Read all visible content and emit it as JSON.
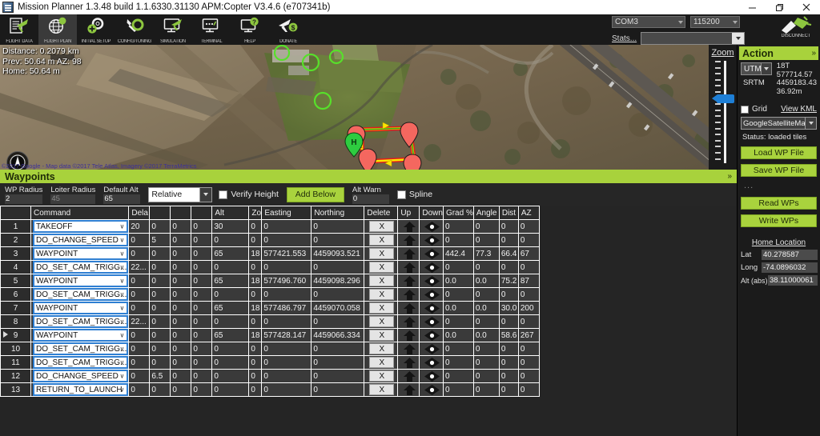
{
  "window": {
    "title": "Mission Planner 1.3.48 build 1.1.6330.31130 APM:Copter V3.4.6 (e707341b)",
    "minimize": "minimize-icon",
    "restore": "restore-icon",
    "close": "close-icon"
  },
  "toolbar": [
    {
      "label": "FLIGHT DATA",
      "icon": "flight-data-icon",
      "active": false
    },
    {
      "label": "FLIGHT PLAN",
      "icon": "flight-plan-icon",
      "active": true
    },
    {
      "label": "INITIAL SETUP",
      "icon": "initial-setup-icon",
      "active": false
    },
    {
      "label": "CONFIG/TUNING",
      "icon": "config-tuning-icon",
      "active": false
    },
    {
      "label": "SIMULATION",
      "icon": "simulation-icon",
      "active": false
    },
    {
      "label": "TERMINAL",
      "icon": "terminal-icon",
      "active": false
    },
    {
      "label": "HELP",
      "icon": "help-icon",
      "active": false
    },
    {
      "label": "DONATE",
      "icon": "donate-icon",
      "active": false
    }
  ],
  "connection": {
    "port": "COM3",
    "baud": "115200",
    "stats_label": "Stats...",
    "status_value": "",
    "disconnect_label": "DISCONNECT"
  },
  "map": {
    "distance": "Distance: 0.2079 km",
    "prev": "Prev: 50.64 m AZ: 98",
    "home": "Home: 50.64 m",
    "attribution": "©2017 Google - Map data ©2017 Tele Atlas, Imagery ©2017 TerraMetrics",
    "zoom_label": "Zoom",
    "compass_icon": "compass-north-icon",
    "home_marker_label": "H"
  },
  "action": {
    "title": "Action",
    "chevron": "»",
    "coord_system": "UTM",
    "srtm_label": "SRTM",
    "utm_zone": "18T",
    "utm_easting": "577714.57",
    "utm_northing": "4459183.43",
    "utm_alt": "36.92m",
    "grid_label": "Grid",
    "view_kml": "View KML",
    "map_source": "GoogleSatelliteMap",
    "status": "Status: loaded tiles",
    "load_wp": "Load WP File",
    "save_wp": "Save WP File",
    "dots": "...",
    "read_wp": "Read WPs",
    "write_wp": "Write WPs",
    "home_location_title": "Home Location",
    "lat_label": "Lat",
    "lat_value": "40.278587",
    "long_label": "Long",
    "long_value": "-74.0896032",
    "alt_label": "Alt (abs)",
    "alt_value": "38.11000061"
  },
  "waypoints_panel": {
    "title": "Waypoints",
    "chevron": "»",
    "wp_radius_label": "WP Radius",
    "wp_radius_value": "2",
    "loiter_radius_label": "Loiter Radius",
    "loiter_radius_value": "45",
    "default_alt_label": "Default Alt",
    "default_alt_value": "65",
    "frame_mode": "Relative",
    "verify_height_label": "Verify Height",
    "add_below_label": "Add Below",
    "alt_warn_label": "Alt Warn",
    "alt_warn_value": "0",
    "spline_label": "Spline"
  },
  "grid": {
    "columns": [
      "",
      "Command",
      "Dela",
      "",
      "",
      "",
      "Alt",
      "Zo",
      "Easting",
      "Northing",
      "Delete",
      "Up",
      "Down",
      "Grad %",
      "Angle",
      "Dist",
      "AZ"
    ],
    "delete_label": "X",
    "rows": [
      {
        "n": "1",
        "selected": false,
        "command": "TAKEOFF",
        "delay": "20",
        "p2": "0",
        "p3": "0",
        "p4": "0",
        "alt": "30",
        "zo": "0",
        "easting": "0",
        "northing": "0",
        "grad": "0",
        "angle": "0",
        "dist": "0",
        "az": "0"
      },
      {
        "n": "2",
        "selected": false,
        "command": "DO_CHANGE_SPEED",
        "delay": "0",
        "p2": "5",
        "p3": "0",
        "p4": "0",
        "alt": "0",
        "zo": "0",
        "easting": "0",
        "northing": "0",
        "grad": "0",
        "angle": "0",
        "dist": "0",
        "az": "0"
      },
      {
        "n": "3",
        "selected": false,
        "command": "WAYPOINT",
        "delay": "0",
        "p2": "0",
        "p3": "0",
        "p4": "0",
        "alt": "65",
        "zo": "18",
        "easting": "577421.553",
        "northing": "4459093.521",
        "grad": "442.4",
        "angle": "77.3",
        "dist": "66.4",
        "az": "67"
      },
      {
        "n": "4",
        "selected": false,
        "command": "DO_SET_CAM_TRIGG...",
        "delay": "22...",
        "p2": "0",
        "p3": "0",
        "p4": "0",
        "alt": "0",
        "zo": "0",
        "easting": "0",
        "northing": "0",
        "grad": "0",
        "angle": "0",
        "dist": "0",
        "az": "0"
      },
      {
        "n": "5",
        "selected": false,
        "command": "WAYPOINT",
        "delay": "0",
        "p2": "0",
        "p3": "0",
        "p4": "0",
        "alt": "65",
        "zo": "18",
        "easting": "577496.760",
        "northing": "4459098.296",
        "grad": "0.0",
        "angle": "0.0",
        "dist": "75.2",
        "az": "87"
      },
      {
        "n": "6",
        "selected": false,
        "command": "DO_SET_CAM_TRIGG...",
        "delay": "0",
        "p2": "0",
        "p3": "0",
        "p4": "0",
        "alt": "0",
        "zo": "0",
        "easting": "0",
        "northing": "0",
        "grad": "0",
        "angle": "0",
        "dist": "0",
        "az": "0"
      },
      {
        "n": "7",
        "selected": false,
        "command": "WAYPOINT",
        "delay": "0",
        "p2": "0",
        "p3": "0",
        "p4": "0",
        "alt": "65",
        "zo": "18",
        "easting": "577486.797",
        "northing": "4459070.058",
        "grad": "0.0",
        "angle": "0.0",
        "dist": "30.0",
        "az": "200"
      },
      {
        "n": "8",
        "selected": false,
        "command": "DO_SET_CAM_TRIGG...",
        "delay": "22...",
        "p2": "0",
        "p3": "0",
        "p4": "0",
        "alt": "0",
        "zo": "0",
        "easting": "0",
        "northing": "0",
        "grad": "0",
        "angle": "0",
        "dist": "0",
        "az": "0"
      },
      {
        "n": "9",
        "selected": true,
        "command": "WAYPOINT",
        "delay": "0",
        "p2": "0",
        "p3": "0",
        "p4": "0",
        "alt": "65",
        "zo": "18",
        "easting": "577428.147",
        "northing": "4459066.334",
        "grad": "0.0",
        "angle": "0.0",
        "dist": "58.6",
        "az": "267"
      },
      {
        "n": "10",
        "selected": false,
        "command": "DO_SET_CAM_TRIGG...",
        "delay": "0",
        "p2": "0",
        "p3": "0",
        "p4": "0",
        "alt": "0",
        "zo": "0",
        "easting": "0",
        "northing": "0",
        "grad": "0",
        "angle": "0",
        "dist": "0",
        "az": "0"
      },
      {
        "n": "11",
        "selected": false,
        "command": "DO_SET_CAM_TRIGG...",
        "delay": "0",
        "p2": "0",
        "p3": "0",
        "p4": "0",
        "alt": "0",
        "zo": "0",
        "easting": "0",
        "northing": "0",
        "grad": "0",
        "angle": "0",
        "dist": "0",
        "az": "0"
      },
      {
        "n": "12",
        "selected": false,
        "command": "DO_CHANGE_SPEED",
        "delay": "0",
        "p2": "6.5",
        "p3": "0",
        "p4": "0",
        "alt": "0",
        "zo": "0",
        "easting": "0",
        "northing": "0",
        "grad": "0",
        "angle": "0",
        "dist": "0",
        "az": "0"
      },
      {
        "n": "13",
        "selected": false,
        "command": "RETURN_TO_LAUNCH",
        "delay": "0",
        "p2": "0",
        "p3": "0",
        "p4": "0",
        "alt": "0",
        "zo": "0",
        "easting": "0",
        "northing": "0",
        "grad": "0",
        "angle": "0",
        "dist": "0",
        "az": "0"
      }
    ]
  },
  "colors": {
    "accent_green": "#a8d23c",
    "panel_dark": "#1b1b1b",
    "grid_cell": "#3a3a3a",
    "selection_blue": "#2f7fd2",
    "marker_red": "#f4675f",
    "marker_green": "#2ecc40",
    "path_yellow": "#ffe400",
    "path_red": "#e01b1b"
  }
}
